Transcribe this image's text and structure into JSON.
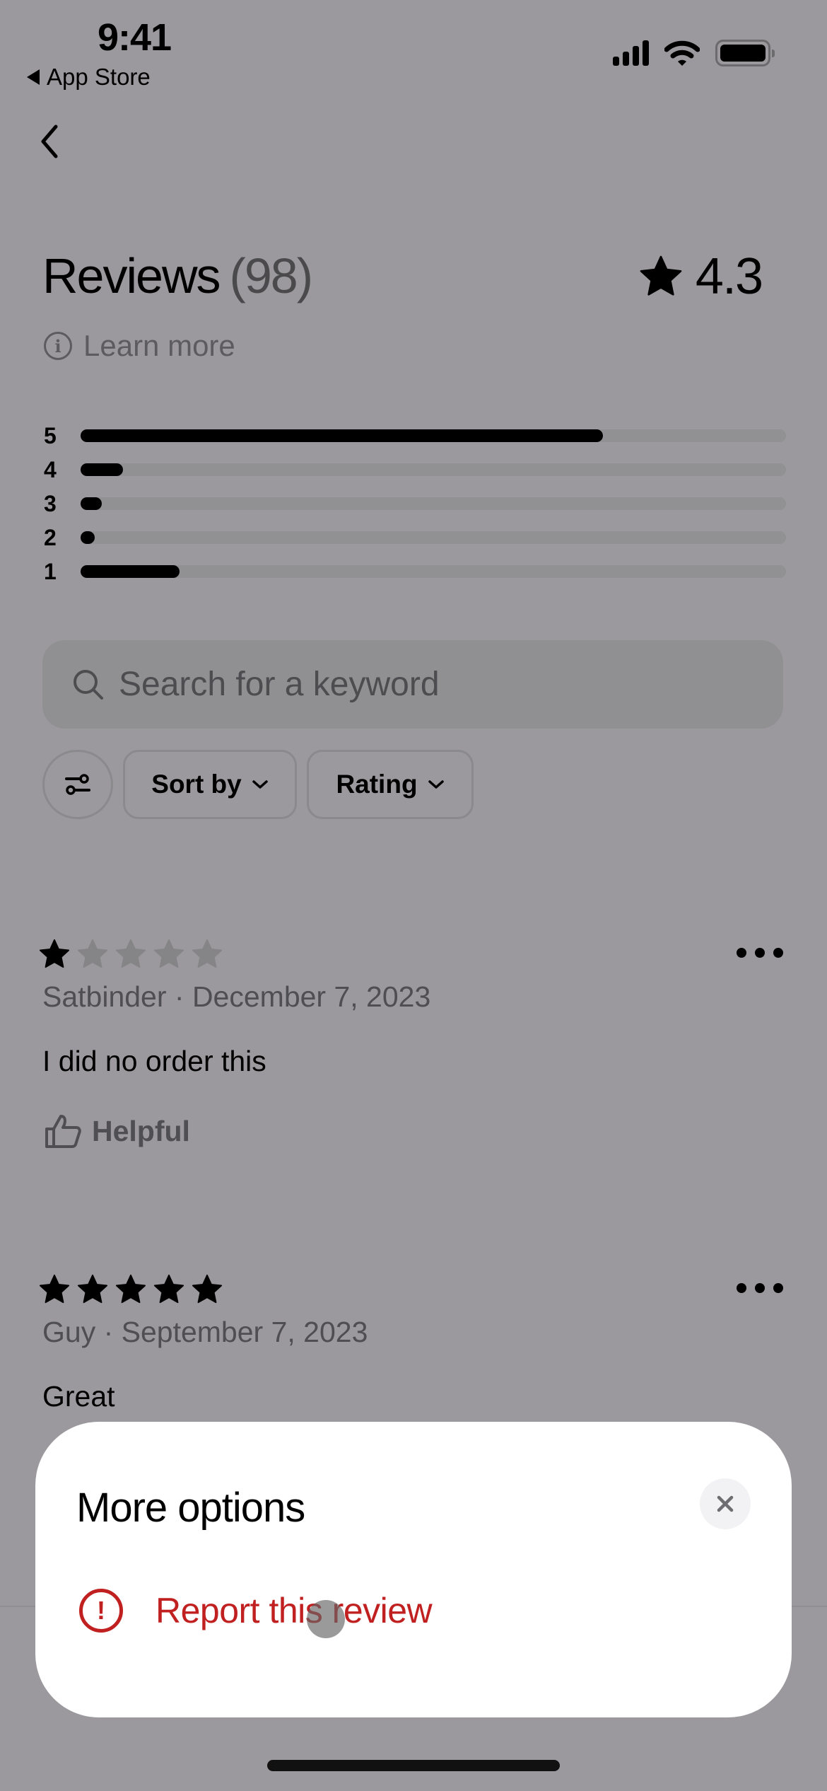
{
  "status_bar": {
    "time": "9:41",
    "back_app_label": "App Store",
    "icons": [
      "cellular-signal-icon",
      "wifi-icon",
      "battery-icon"
    ]
  },
  "nav": {
    "back_icon": "chevron-left-icon"
  },
  "header": {
    "title": "Reviews",
    "count": "(98)",
    "average_rating": "4.3",
    "rating_icon": "star-icon",
    "learn_more_label": "Learn more"
  },
  "rating_distribution": [
    {
      "stars": "5",
      "fraction": 0.74
    },
    {
      "stars": "4",
      "fraction": 0.06
    },
    {
      "stars": "3",
      "fraction": 0.03
    },
    {
      "stars": "2",
      "fraction": 0.02
    },
    {
      "stars": "1",
      "fraction": 0.14
    }
  ],
  "search": {
    "placeholder": "Search for a keyword",
    "value": ""
  },
  "filters": {
    "filter_icon": "sliders-icon",
    "sort_label": "Sort by",
    "rating_label": "Rating"
  },
  "reviews": [
    {
      "rating": 1,
      "meta": "Satbinder · December 7, 2023",
      "text": "I did no order this",
      "helpful_label": "Helpful"
    },
    {
      "rating": 5,
      "meta": "Guy · September 7, 2023",
      "text": "Great"
    }
  ],
  "sheet": {
    "title": "More options",
    "close_icon": "close-icon",
    "options": [
      {
        "label": "Report this review",
        "icon": "alert-circle-icon"
      }
    ]
  },
  "colors": {
    "overlay_background": "#9b999d",
    "danger": "#c0201f",
    "sheet_background": "#ffffff"
  }
}
